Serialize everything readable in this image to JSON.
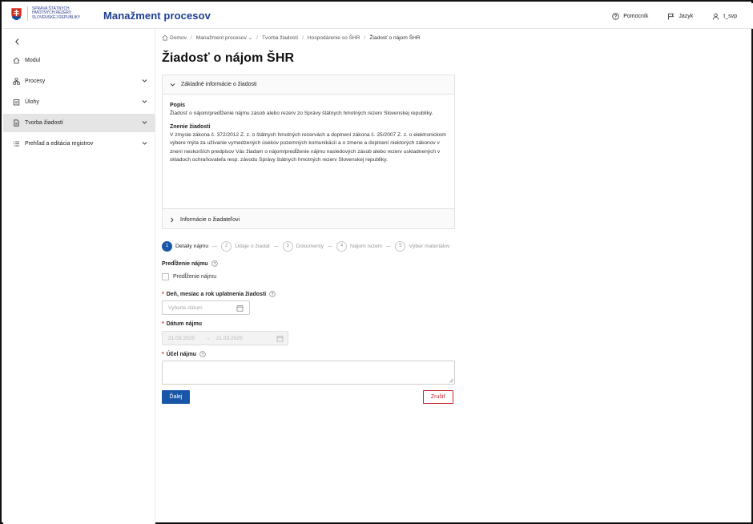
{
  "header": {
    "logo_lines": [
      "SPRÁVA ŠTÁTNYCH",
      "HMOTNÝCH REZERV",
      "SLOVENSKEJ REPUBLIKY"
    ],
    "app_title": "Manažment procesov",
    "help_label": "Pomocník",
    "language_label": "Jazyk",
    "user_label": "t_svp"
  },
  "sidebar": {
    "items": [
      {
        "label": "Modul",
        "icon": "home-icon",
        "has_chevron": false,
        "active": false
      },
      {
        "label": "Procesy",
        "icon": "process-icon",
        "has_chevron": true,
        "active": false
      },
      {
        "label": "Úlohy",
        "icon": "task-icon",
        "has_chevron": true,
        "active": false
      },
      {
        "label": "Tvorba žiadostí",
        "icon": "document-icon",
        "has_chevron": true,
        "active": true
      },
      {
        "label": "Prehľad a editácia registrov",
        "icon": "list-icon",
        "has_chevron": true,
        "active": false
      }
    ]
  },
  "breadcrumb": {
    "home": "Domov",
    "items": [
      "Manažment procesov",
      "Tvorba žiadostí",
      "Hospodárenie so ŠHR"
    ],
    "current": "Žiadosť o nájom ŠHR"
  },
  "page_title": "Žiadosť o nájom ŠHR",
  "info_panel": {
    "section1_title": "Základné informácie o žiadosti",
    "popis_label": "Popis",
    "popis_text": "Žiadosť o nájom/predĺženie nájmu zásob alebo rezerv zo Správy štátnych hmotných rezerv Slovenskej republiky.",
    "znenie_label": "Znenie žiadosti",
    "znenie_text": "V zmysle zákona č. 372/2012 Z. z. o štátnych hmotných rezervách a doplnení zákona č. 25/2007 Z. z. o elektronickom výbere mýta za užívanie vymedzených úsekov pozemných komunikácií a o zmene a doplnení niektorých zákonov v znení neskorších predpisov Vás žiadam o nájom/predĺženie nájmu nasledových zásob alebo rezerv uskladnených v skladoch ochraňovateľa resp. závodu Správy štátnych hmotných rezerv Slovenskej republiky.",
    "section2_title": "Informácie o žiadateľovi"
  },
  "steps": [
    {
      "num": "1",
      "label": "Detaily nájmu",
      "active": true
    },
    {
      "num": "2",
      "label": "Údaje o žiadat",
      "active": false
    },
    {
      "num": "3",
      "label": "Dokumenty",
      "active": false
    },
    {
      "num": "4",
      "label": "Nájom rezerv",
      "active": false
    },
    {
      "num": "5",
      "label": "Výber materiálov",
      "active": false
    }
  ],
  "form": {
    "extension_label": "Predĺženie nájmu",
    "extension_checkbox_label": "Predĺženie nájmu",
    "date_label": "Deň, mesiac a rok uplatnenia žiadosti",
    "date_placeholder": "Vyberte dátum",
    "rental_date_label": "Dátum nájmu",
    "rental_from": "21.03.2025",
    "rental_to": "21.03.2025",
    "purpose_label": "Účel nájmu",
    "next_button": "Ďalej",
    "cancel_button": "Zrušiť"
  },
  "colors": {
    "brand_blue": "#1d3f91",
    "primary_button": "#1a56a7",
    "danger": "#c0262d",
    "required": "#d12b2b"
  }
}
